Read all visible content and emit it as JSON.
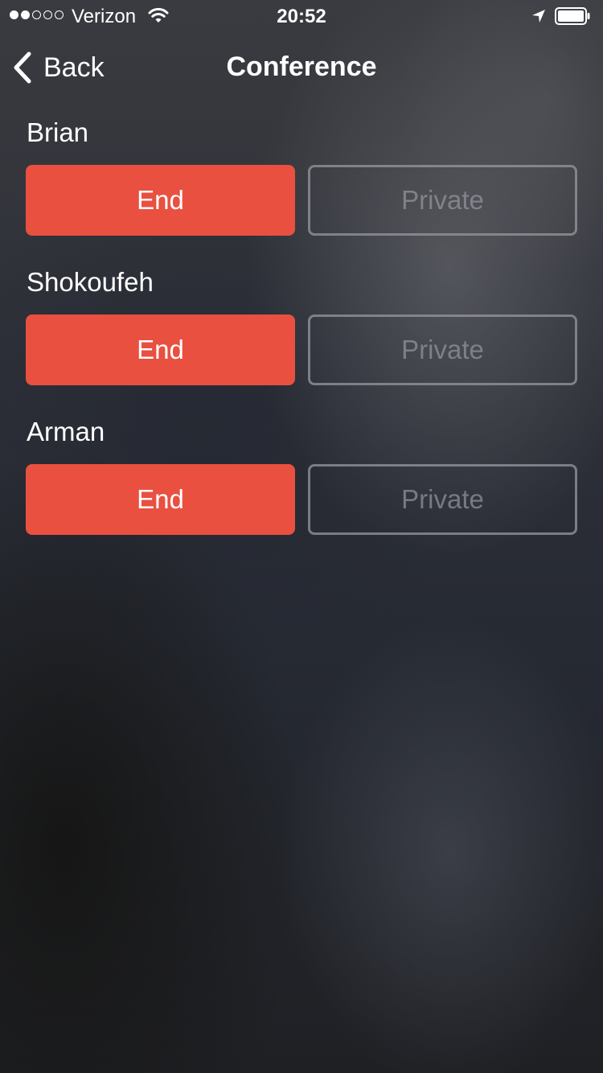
{
  "status_bar": {
    "signal_dots_filled": 2,
    "signal_dots_total": 5,
    "carrier": "Verizon",
    "time": "20:52",
    "icons": [
      "wifi-icon",
      "location-arrow-icon",
      "battery-icon"
    ]
  },
  "nav": {
    "back_label": "Back",
    "title": "Conference"
  },
  "participants": [
    {
      "name": "Brian",
      "end_label": "End",
      "private_label": "Private"
    },
    {
      "name": "Shokoufeh",
      "end_label": "End",
      "private_label": "Private"
    },
    {
      "name": "Arman",
      "end_label": "End",
      "private_label": "Private"
    }
  ],
  "colors": {
    "end_button": "#e95040",
    "private_button_border": "#96989e"
  }
}
